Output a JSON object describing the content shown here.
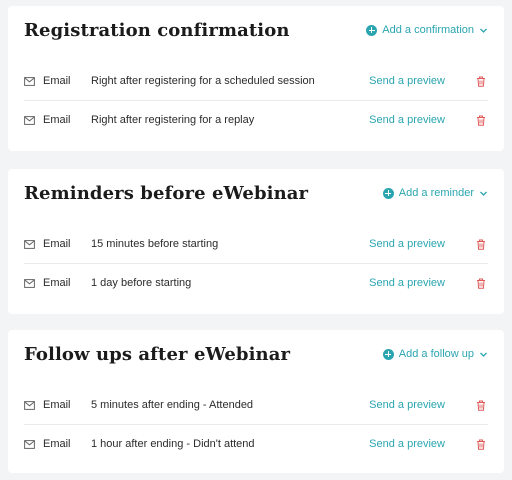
{
  "colors": {
    "accent": "#2aa5b0",
    "danger": "#e05a5a",
    "background": "#f2f4f5",
    "card": "#ffffff",
    "text": "#2b2b2b"
  },
  "sections": [
    {
      "title": "Registration confirmation",
      "add_label": "Add a confirmation",
      "add_icon": "plus-circle-icon",
      "rows": [
        {
          "icon": "mail-icon",
          "channel": "Email",
          "description": "Right after registering for a scheduled session",
          "action": "Send a preview",
          "delete_icon": "trash-icon"
        },
        {
          "icon": "mail-icon",
          "channel": "Email",
          "description": "Right after registering for a replay",
          "action": "Send a preview",
          "delete_icon": "trash-icon"
        }
      ]
    },
    {
      "title": "Reminders before eWebinar",
      "add_label": "Add a reminder",
      "add_icon": "plus-circle-icon",
      "rows": [
        {
          "icon": "mail-icon",
          "channel": "Email",
          "description": "15 minutes before starting",
          "action": "Send a preview",
          "delete_icon": "trash-icon"
        },
        {
          "icon": "mail-icon",
          "channel": "Email",
          "description": "1 day before starting",
          "action": "Send a preview",
          "delete_icon": "trash-icon"
        }
      ]
    },
    {
      "title": "Follow ups after eWebinar",
      "add_label": "Add a follow up",
      "add_icon": "plus-circle-icon",
      "rows": [
        {
          "icon": "mail-icon",
          "channel": "Email",
          "description": "5 minutes after ending - Attended",
          "action": "Send a preview",
          "delete_icon": "trash-icon"
        },
        {
          "icon": "mail-icon",
          "channel": "Email",
          "description": "1 hour after ending - Didn't attend",
          "action": "Send a preview",
          "delete_icon": "trash-icon"
        }
      ]
    }
  ]
}
